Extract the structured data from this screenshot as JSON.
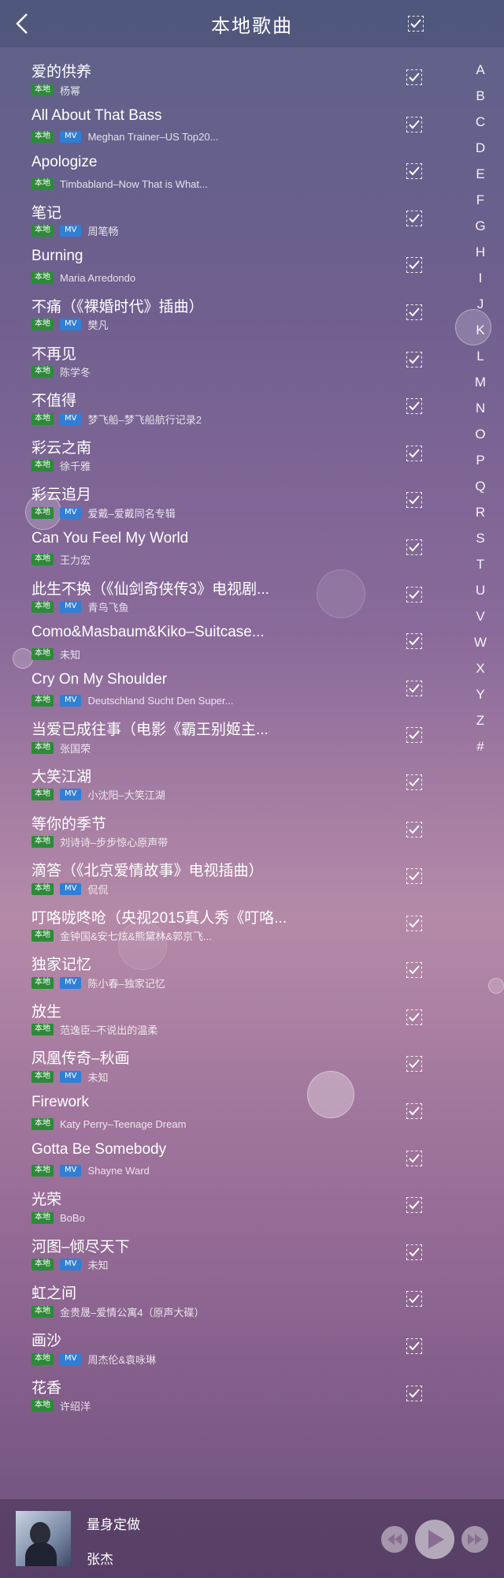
{
  "header": {
    "title": "本地歌曲"
  },
  "badges": {
    "local": "本地",
    "mv": "MV"
  },
  "songs": [
    {
      "title": "爱的供养",
      "artist": "杨幂",
      "mv": false
    },
    {
      "title": "All About That Bass",
      "artist": "Meghan Trainer–US Top20...",
      "mv": true
    },
    {
      "title": "Apologize",
      "artist": "Timbabland–Now That is What...",
      "mv": false
    },
    {
      "title": "笔记",
      "artist": "周笔畅",
      "mv": true
    },
    {
      "title": "Burning",
      "artist": "Maria Arredondo",
      "mv": false
    },
    {
      "title": "不痛（《裸婚时代》插曲）",
      "artist": "樊凡",
      "mv": true
    },
    {
      "title": "不再见",
      "artist": "陈学冬",
      "mv": false
    },
    {
      "title": "不值得",
      "artist": "梦飞船–梦飞船航行记录2",
      "mv": true
    },
    {
      "title": "彩云之南",
      "artist": "徐千雅",
      "mv": false
    },
    {
      "title": "彩云追月",
      "artist": "爱戴–爱戴同名专辑",
      "mv": true
    },
    {
      "title": "Can You Feel My World",
      "artist": "王力宏",
      "mv": false
    },
    {
      "title": "此生不换（《仙剑奇侠传3》电视剧...",
      "artist": "青鸟飞鱼",
      "mv": true
    },
    {
      "title": "Como&Masbaum&Kiko–Suitcase...",
      "artist": "未知",
      "mv": false
    },
    {
      "title": "Cry On My Shoulder",
      "artist": "Deutschland Sucht Den Super...",
      "mv": true
    },
    {
      "title": "当爱已成往事（电影《霸王别姬主...",
      "artist": "张国荣",
      "mv": false
    },
    {
      "title": "大笑江湖",
      "artist": "小沈阳–大笑江湖",
      "mv": true
    },
    {
      "title": "等你的季节",
      "artist": "刘诗诗–步步惊心原声带",
      "mv": false
    },
    {
      "title": "滴答（《北京爱情故事》电视插曲）",
      "artist": "侃侃",
      "mv": true
    },
    {
      "title": "叮咯咙咚呛（央视2015真人秀《叮咯...",
      "artist": "金钟国&安七炫&熊黛林&郭京飞...",
      "mv": false
    },
    {
      "title": "独家记忆",
      "artist": "陈小春–独家记忆",
      "mv": true
    },
    {
      "title": "放生",
      "artist": "范逸臣–不说出的温柔",
      "mv": false
    },
    {
      "title": "凤凰传奇–秋画",
      "artist": "未知",
      "mv": true
    },
    {
      "title": "Firework",
      "artist": "Katy Perry–Teenage Dream",
      "mv": false
    },
    {
      "title": "Gotta Be Somebody",
      "artist": "Shayne Ward",
      "mv": true
    },
    {
      "title": "光荣",
      "artist": "BoBo",
      "mv": false
    },
    {
      "title": "河图–倾尽天下",
      "artist": "未知",
      "mv": true
    },
    {
      "title": "虹之间",
      "artist": "金贵晟–爱情公寓4（原声大碟）",
      "mv": false
    },
    {
      "title": "画沙",
      "artist": "周杰伦&袁咏琳",
      "mv": true
    },
    {
      "title": "花香",
      "artist": "许绍洋",
      "mv": false
    }
  ],
  "index_letters": [
    "A",
    "B",
    "C",
    "D",
    "E",
    "F",
    "G",
    "H",
    "I",
    "J",
    "K",
    "L",
    "M",
    "N",
    "O",
    "P",
    "Q",
    "R",
    "S",
    "T",
    "U",
    "V",
    "W",
    "X",
    "Y",
    "Z",
    "#"
  ],
  "player": {
    "title": "量身定做",
    "artist": "张杰"
  }
}
